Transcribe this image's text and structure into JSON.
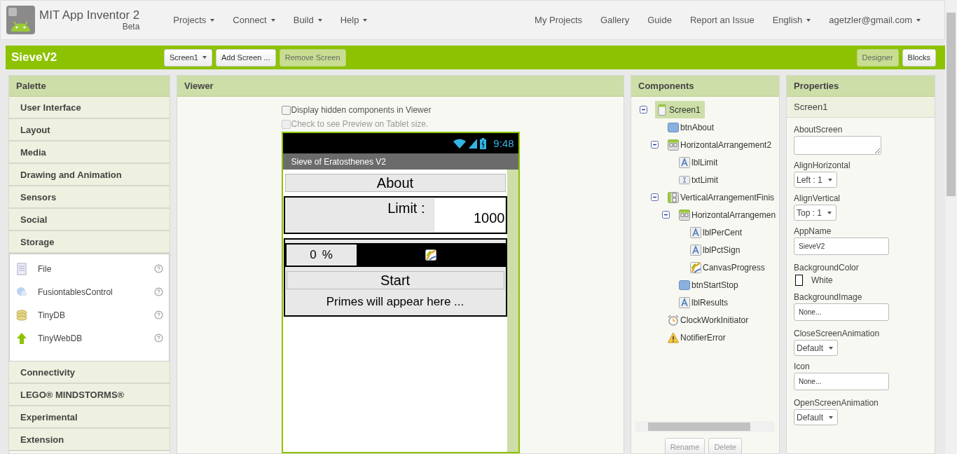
{
  "header": {
    "title": "MIT App Inventor 2",
    "subtitle": "Beta",
    "menus": [
      {
        "label": "Projects",
        "dropdown": true
      },
      {
        "label": "Connect",
        "dropdown": true
      },
      {
        "label": "Build",
        "dropdown": true
      },
      {
        "label": "Help",
        "dropdown": true
      }
    ],
    "links": [
      {
        "label": "My Projects",
        "dropdown": false
      },
      {
        "label": "Gallery",
        "dropdown": false
      },
      {
        "label": "Guide",
        "dropdown": false
      },
      {
        "label": "Report an Issue",
        "dropdown": false
      },
      {
        "label": "English",
        "dropdown": true
      },
      {
        "label": "agetzler@gmail.com",
        "dropdown": true
      }
    ]
  },
  "project_bar": {
    "name": "SieveV2",
    "screen_select": "Screen1",
    "buttons": [
      {
        "label": "Add Screen ...",
        "disabled": false
      },
      {
        "label": "Remove Screen",
        "disabled": true
      }
    ],
    "views": [
      {
        "label": "Designer",
        "selected": true
      },
      {
        "label": "Blocks",
        "selected": false
      }
    ]
  },
  "palette": {
    "title": "Palette",
    "categories": [
      {
        "label": "User Interface"
      },
      {
        "label": "Layout"
      },
      {
        "label": "Media"
      },
      {
        "label": "Drawing and Animation"
      },
      {
        "label": "Sensors"
      },
      {
        "label": "Social"
      },
      {
        "label": "Storage",
        "items": [
          {
            "label": "File",
            "kind": "file"
          },
          {
            "label": "FusiontablesControl",
            "kind": "fusion"
          },
          {
            "label": "TinyDB",
            "kind": "db"
          },
          {
            "label": "TinyWebDB",
            "kind": "web"
          }
        ]
      },
      {
        "label": "Connectivity"
      },
      {
        "label": "LEGO® MINDSTORMS®"
      },
      {
        "label": "Experimental"
      },
      {
        "label": "Extension"
      }
    ]
  },
  "viewer": {
    "title": "Viewer",
    "options": [
      {
        "label": "Display hidden components in Viewer",
        "checked": false,
        "disabled": false
      },
      {
        "label": "Check to see Preview on Tablet size.",
        "checked": false,
        "disabled": true
      }
    ],
    "phone": {
      "time": "9:48",
      "app_title": "Sieve of Eratosthenes V2",
      "about_button": "About",
      "limit_label": "Limit :",
      "limit_value": "1000",
      "percent_value": "0",
      "percent_sign": "%",
      "start_button": "Start",
      "results_label": "Primes will appear here ..."
    }
  },
  "components": {
    "title": "Components",
    "tree": [
      {
        "name": "Screen1",
        "kind": "screen",
        "selected": true,
        "expanded": true,
        "children": [
          {
            "name": "btnAbout",
            "kind": "button",
            "selected": false
          },
          {
            "name": "HorizontalArrangement2",
            "kind": "horizontal",
            "selected": false,
            "expanded": true,
            "children": [
              {
                "name": "lblLimit",
                "kind": "label",
                "selected": false
              },
              {
                "name": "txtLimit",
                "kind": "textbox",
                "selected": false
              }
            ]
          },
          {
            "name": "VerticalArrangementFinis",
            "kind": "vertical",
            "selected": false,
            "expanded": true,
            "children": [
              {
                "name": "HorizontalArrangemen",
                "kind": "horizontal",
                "selected": false,
                "expanded": true,
                "children": [
                  {
                    "name": "lblPerCent",
                    "kind": "label",
                    "selected": false
                  },
                  {
                    "name": "lblPctSign",
                    "kind": "label",
                    "selected": false
                  },
                  {
                    "name": "CanvasProgress",
                    "kind": "canvas",
                    "selected": false
                  }
                ]
              },
              {
                "name": "btnStartStop",
                "kind": "button",
                "selected": false
              },
              {
                "name": "lblResults",
                "kind": "label",
                "selected": false
              }
            ]
          },
          {
            "name": "ClockWorkInitiator",
            "kind": "clock",
            "selected": false
          },
          {
            "name": "NotifierError",
            "kind": "notifier",
            "selected": false
          }
        ]
      }
    ],
    "buttons": [
      {
        "label": "Rename",
        "disabled": true
      },
      {
        "label": "Delete",
        "disabled": true
      }
    ]
  },
  "properties": {
    "title": "Properties",
    "component": "Screen1",
    "items": [
      {
        "label": "AboutScreen",
        "kind": "textarea"
      },
      {
        "label": "AlignHorizontal",
        "kind": "select",
        "value": "Left : 1"
      },
      {
        "label": "AlignVertical",
        "kind": "select",
        "value": "Top : 1"
      },
      {
        "label": "AppName",
        "kind": "text",
        "value": "SieveV2"
      },
      {
        "label": "BackgroundColor",
        "kind": "color",
        "value": "White",
        "color": "#ffffff"
      },
      {
        "label": "BackgroundImage",
        "kind": "text",
        "value": "None..."
      },
      {
        "label": "CloseScreenAnimation",
        "kind": "select",
        "value": "Default"
      },
      {
        "label": "Icon",
        "kind": "text",
        "value": "None..."
      },
      {
        "label": "OpenScreenAnimation",
        "kind": "select",
        "value": "Default"
      }
    ]
  }
}
